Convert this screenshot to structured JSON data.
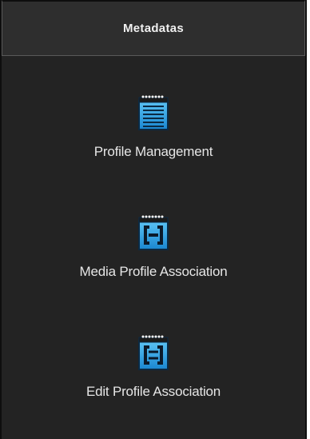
{
  "panel": {
    "title": "Metadatas",
    "items": [
      {
        "label": "Profile Management",
        "icon": "notepad-lines-icon"
      },
      {
        "label": "Media Profile Association",
        "icon": "notepad-link-icon"
      },
      {
        "label": "Edit Profile Association",
        "icon": "notepad-edit-link-icon"
      }
    ]
  },
  "colors": {
    "background": "#232323",
    "header": "#2e2e2e",
    "icon_blue": "#2aa3e8",
    "text": "#e6e6e6"
  }
}
